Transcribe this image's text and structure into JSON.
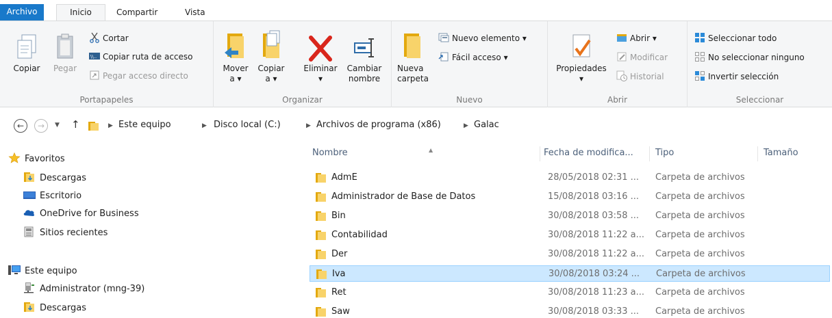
{
  "ribbon_tabs": [
    "Archivo",
    "Inicio",
    "Compartir",
    "Vista"
  ],
  "clipboard": {
    "copy": "Copiar",
    "paste": "Pegar",
    "cut": "Cortar",
    "copy_path": "Copiar ruta de acceso",
    "paste_shortcut": "Pegar acceso directo",
    "group_label": "Portapapeles"
  },
  "organize": {
    "move_line1": "Mover",
    "move_line2": "a ▾",
    "copy_line1": "Copiar",
    "copy_line2": "a ▾",
    "delete": "Eliminar",
    "delete_arrow": "▾",
    "rename_line1": "Cambiar",
    "rename_line2": "nombre",
    "group_label": "Organizar"
  },
  "new": {
    "new_folder_line1": "Nueva",
    "new_folder_line2": "carpeta",
    "new_item": "Nuevo elemento ▾",
    "easy_access": "Fácil acceso ▾",
    "group_label": "Nuevo"
  },
  "open": {
    "properties": "Propiedades",
    "properties_arrow": "▾",
    "open": "Abrir ▾",
    "edit": "Modificar",
    "history": "Historial",
    "group_label": "Abrir"
  },
  "select": {
    "select_all": "Seleccionar todo",
    "select_none": "No seleccionar ninguno",
    "invert": "Invertir selección",
    "group_label": "Seleccionar"
  },
  "address": {
    "crumbs": [
      "Este equipo",
      "Disco local (C:)",
      "Archivos de programa (x86)",
      "Galac"
    ]
  },
  "navpane": {
    "favorites": "Favoritos",
    "fav_items": [
      "Descargas",
      "Escritorio",
      "OneDrive for Business",
      "Sitios recientes"
    ],
    "this_pc": "Este equipo",
    "pc_items": [
      "Administrator (mng-39)",
      "Descargas"
    ]
  },
  "columns": {
    "name": "Nombre",
    "date": "Fecha de modifica...",
    "type": "Tipo",
    "size": "Tamaño"
  },
  "files": [
    {
      "name": "AdmE",
      "date": "28/05/2018 02:31 ...",
      "type": "Carpeta de archivos",
      "selected": false
    },
    {
      "name": "Administrador de Base de Datos",
      "date": "15/08/2018 03:16 ...",
      "type": "Carpeta de archivos",
      "selected": false
    },
    {
      "name": "Bin",
      "date": "30/08/2018 03:58 ...",
      "type": "Carpeta de archivos",
      "selected": false
    },
    {
      "name": "Contabilidad",
      "date": "30/08/2018 11:22 a...",
      "type": "Carpeta de archivos",
      "selected": false
    },
    {
      "name": "Der",
      "date": "30/08/2018 11:22 a...",
      "type": "Carpeta de archivos",
      "selected": false
    },
    {
      "name": "Iva",
      "date": "30/08/2018 03:24 ...",
      "type": "Carpeta de archivos",
      "selected": true
    },
    {
      "name": "Ret",
      "date": "30/08/2018 11:23 a...",
      "type": "Carpeta de archivos",
      "selected": false
    },
    {
      "name": "Saw",
      "date": "30/08/2018 03:33 ...",
      "type": "Carpeta de archivos",
      "selected": false
    }
  ],
  "colors": {
    "file_tab": "#1979ca",
    "selection_bg": "#cce8ff",
    "selection_border": "#99d1ff",
    "folder_yellow": "#f8d36a"
  }
}
